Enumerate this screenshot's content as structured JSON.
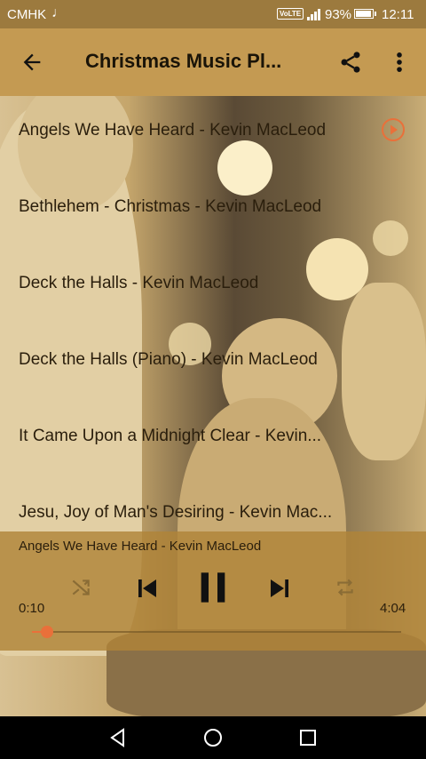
{
  "status_bar": {
    "carrier": "CMHK",
    "note_icon": "♩",
    "volte": "VoLTE",
    "battery_pct": "93%",
    "battery_level": 0.93,
    "time": "12:11"
  },
  "toolbar": {
    "title": "Christmas Music Pl...",
    "back_icon": "arrow-left-icon",
    "share_icon": "share-icon",
    "more_icon": "more-vert-icon"
  },
  "songs": [
    {
      "title": "Angels We Have Heard - Kevin MacLeod",
      "playing": true
    },
    {
      "title": "Bethlehem - Christmas - Kevin MacLeod",
      "playing": false
    },
    {
      "title": "Deck the Halls - Kevin MacLeod",
      "playing": false
    },
    {
      "title": "Deck the Halls (Piano) -  Kevin MacLeod",
      "playing": false
    },
    {
      "title": "It Came Upon a Midnight Clear - Kevin...",
      "playing": false
    },
    {
      "title": "Jesu, Joy of Man's Desiring - Kevin Mac...",
      "playing": false
    }
  ],
  "player": {
    "now_playing": "Angels We Have Heard - Kevin MacLeod",
    "elapsed": "0:10",
    "total": "4:04",
    "progress": 0.04
  },
  "colors": {
    "accent": "#e9703a",
    "toolbar": "#c49a52",
    "status_bar": "#9c7a3e"
  }
}
